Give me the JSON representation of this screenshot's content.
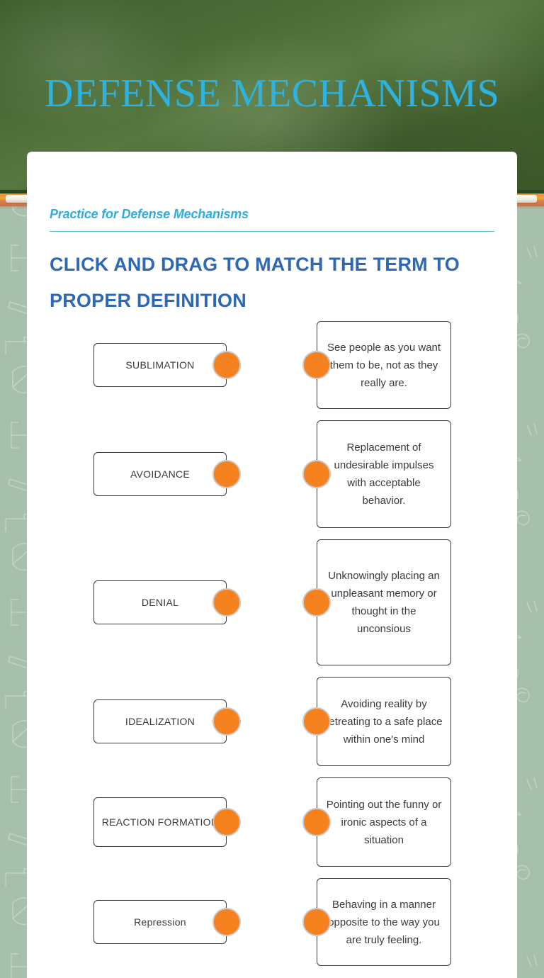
{
  "board": {
    "title": "DEFENSE MECHANISMS",
    "title_color": "#2eb3e0",
    "board_color": "#4a6a36",
    "ledge_color": "#e9922b"
  },
  "worksheet": {
    "subtitle": "Practice for Defense Mechanisms",
    "subtitle_color": "#2eace0",
    "instruction": "Click and drag to match the term to proper definition",
    "instruction_color": "#2f68b2",
    "accent_dot_color": "#f5821f",
    "page_background_color": "#a6c0ab"
  },
  "matching": {
    "rows": [
      {
        "term": "SUBLIMATION",
        "definition": "See people as you want them to be, not as they really are.",
        "term_box_height": 62,
        "def_box_height": 124
      },
      {
        "term": "AVOIDANCE",
        "definition": "Replacement of undesirable impulses with acceptable behavior.",
        "term_box_height": 62,
        "def_box_height": 152
      },
      {
        "term": "DENIAL",
        "definition": "Unknowingly placing an unpleasant memory or thought in the unconsious",
        "term_box_height": 62,
        "def_box_height": 178
      },
      {
        "term": "IDEALIZATION",
        "definition": "Avoiding reality by retreating to a safe place within one's mind",
        "term_box_height": 62,
        "def_box_height": 126
      },
      {
        "term": "REACTION FORMATION",
        "definition": "Pointing out the funny or ironic aspects of a situation",
        "term_box_height": 70,
        "def_box_height": 126
      },
      {
        "term": "Repression",
        "definition": "Behaving in a manner opposite to the way you are truly feeling.",
        "term_box_height": 62,
        "def_box_height": 124
      }
    ]
  }
}
